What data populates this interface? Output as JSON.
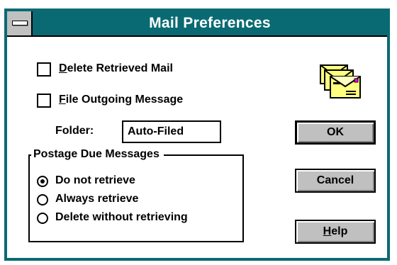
{
  "window": {
    "title": "Mail Preferences"
  },
  "options": {
    "delete_retrieved": {
      "mnemonic": "D",
      "rest": "elete Retrieved Mail",
      "checked": false
    },
    "file_outgoing": {
      "mnemonic": "F",
      "rest": "ile Outgoing Message",
      "checked": false
    }
  },
  "folder": {
    "label": "Folder:",
    "value": "Auto-Filed"
  },
  "postage_due": {
    "title": "Postage Due Messages",
    "options": [
      {
        "label": "Do not retrieve",
        "selected": true
      },
      {
        "label": "Always retrieve",
        "selected": false
      },
      {
        "label": "Delete without retrieving",
        "selected": false
      }
    ]
  },
  "buttons": {
    "ok": "OK",
    "cancel": "Cancel",
    "help_mnemonic": "H",
    "help_rest": "elp"
  },
  "icon": "mail-envelopes-icon",
  "colors": {
    "titlebar": "#0a6a73",
    "envelope": "#ffff80"
  }
}
